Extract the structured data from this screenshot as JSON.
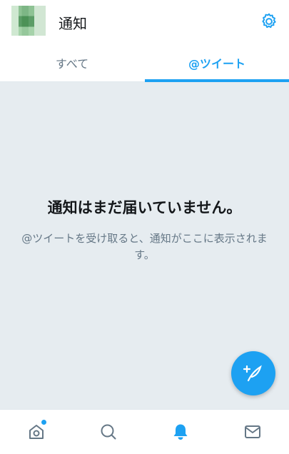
{
  "header": {
    "title": "通知",
    "settings_icon": "gear-icon"
  },
  "tabs": [
    {
      "label": "すべて",
      "active": false
    },
    {
      "label": "@ツイート",
      "active": true
    }
  ],
  "empty_state": {
    "title": "通知はまだ届いていません。",
    "description": "@ツイートを受け取ると、通知がここに表示されます。"
  },
  "fab": {
    "icon": "compose-tweet-icon"
  },
  "bottom_nav": [
    {
      "icon": "home-icon",
      "active": false,
      "has_badge": true
    },
    {
      "icon": "search-icon",
      "active": false
    },
    {
      "icon": "bell-icon",
      "active": true
    },
    {
      "icon": "mail-icon",
      "active": false
    }
  ],
  "colors": {
    "accent": "#1da1f2",
    "secondary_text": "#657786",
    "background": "#e6ecf0"
  }
}
